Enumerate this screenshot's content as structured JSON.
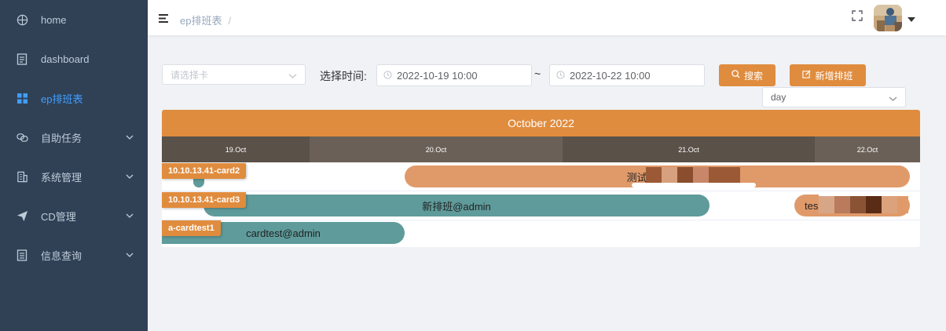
{
  "sidebar": {
    "items": [
      {
        "label": "home",
        "icon": "home-icon"
      },
      {
        "label": "dashboard",
        "icon": "dashboard-icon"
      },
      {
        "label": "ep排班表",
        "icon": "grid-icon"
      },
      {
        "label": "自助任务",
        "icon": "link-icon"
      },
      {
        "label": "系统管理",
        "icon": "building-icon"
      },
      {
        "label": "CD管理",
        "icon": "send-icon"
      },
      {
        "label": "信息查询",
        "icon": "document-icon"
      }
    ],
    "active_color": "#409eff",
    "background": "#304156"
  },
  "navbar": {
    "breadcrumb": "ep排班表",
    "separator": "/"
  },
  "filters": {
    "card_select_placeholder": "请选择卡",
    "time_label": "选择时间:",
    "start_time": "2022-10-19 10:00",
    "end_time": "2022-10-22 10:00",
    "range_separator": "~",
    "search_label": "搜索",
    "add_label": "新增排班",
    "view_select_value": "day"
  },
  "gantt": {
    "month": "October 2022",
    "days": [
      "19.Oct",
      "20.Oct",
      "21.Oct",
      "22.Oct"
    ],
    "rows": [
      {
        "tag": "10.10.13.41-card2",
        "bars": [
          {
            "label": "",
            "color": "teal"
          },
          {
            "label": "测试排班信息",
            "color": "orange"
          }
        ]
      },
      {
        "tag": "10.10.13.41-card3",
        "bars": [
          {
            "label": "新排班@admin",
            "color": "teal"
          },
          {
            "label": "tes",
            "color": "orange"
          }
        ]
      },
      {
        "tag": "a-cardtest1",
        "bars": [
          {
            "label": "cardtest@admin",
            "color": "teal"
          }
        ]
      }
    ],
    "accent_color": "#e08c3e",
    "teal_color": "#5f9b9b"
  }
}
